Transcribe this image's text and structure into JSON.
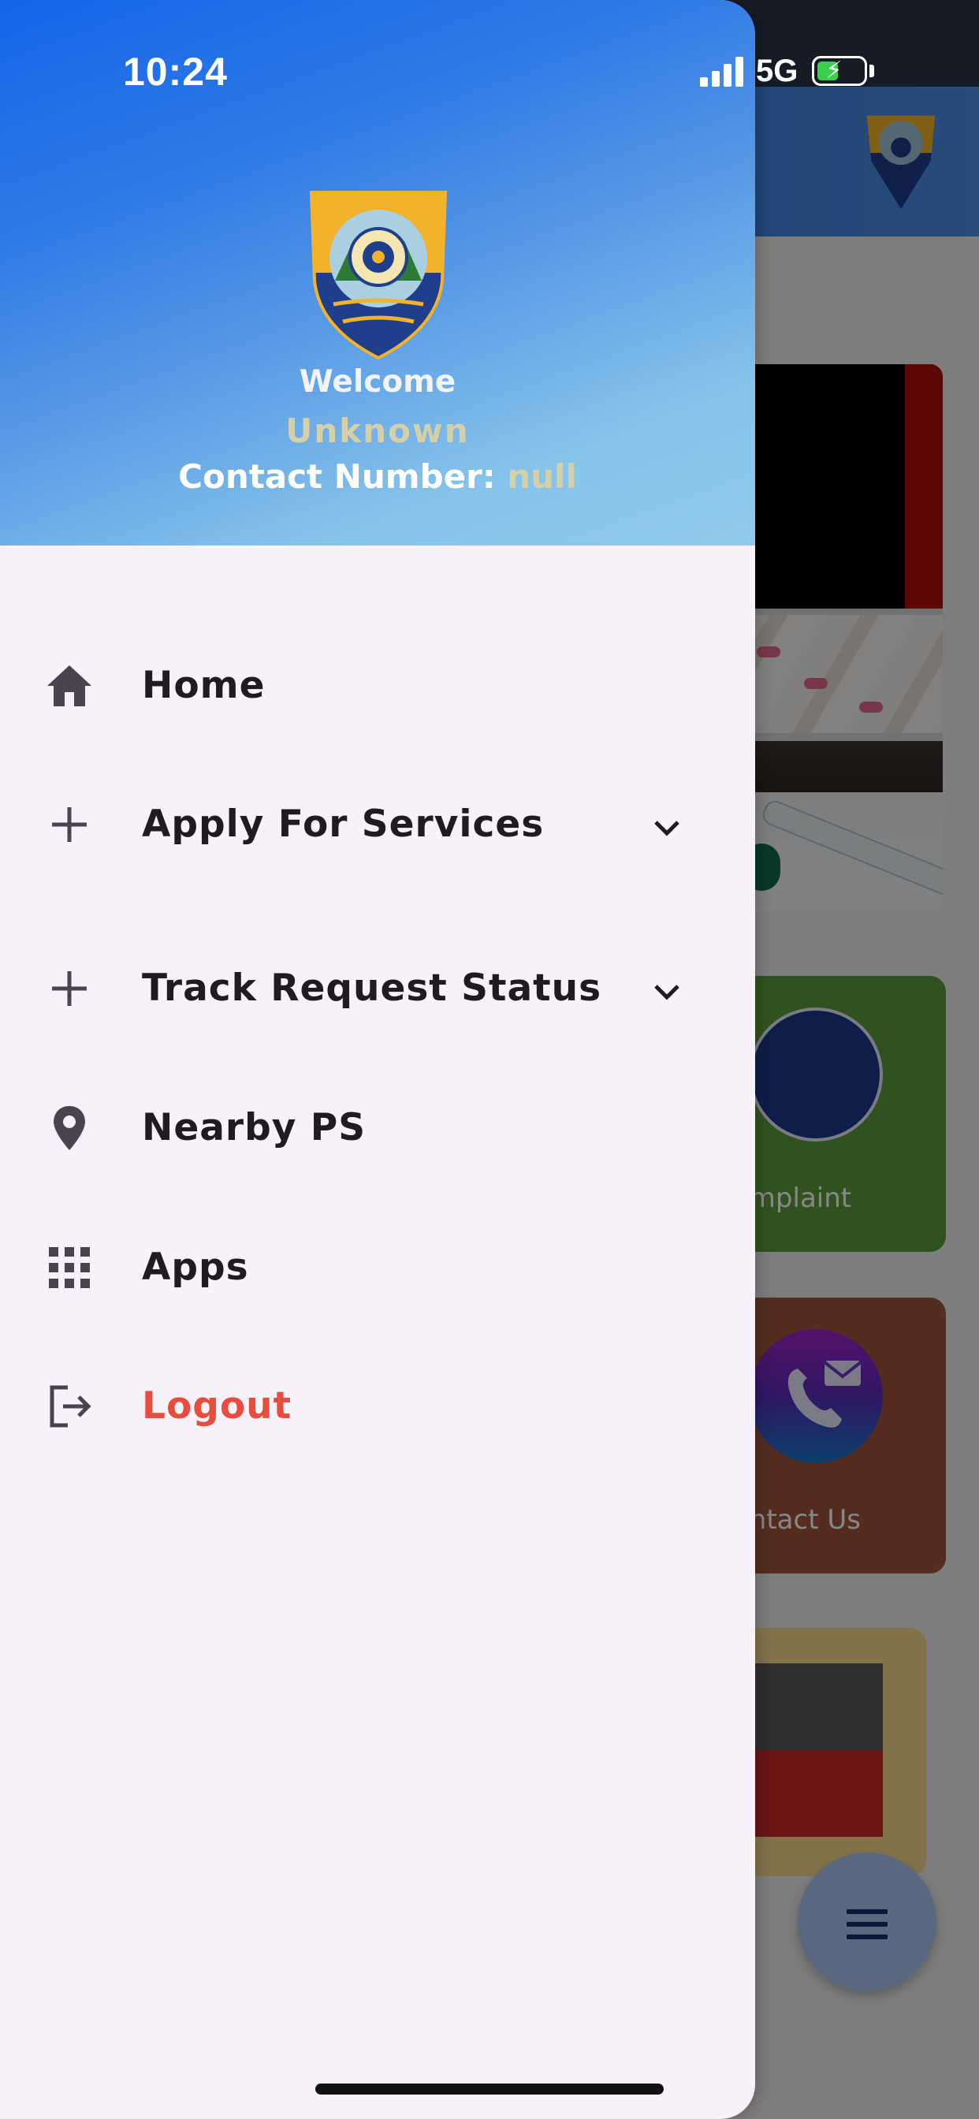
{
  "status_bar": {
    "time": "10:24",
    "network": "5G"
  },
  "drawer": {
    "header": {
      "welcome_label": "Welcome",
      "user_name": "Unknown",
      "contact_label": "Contact Number:",
      "contact_value": "null"
    },
    "menu": [
      {
        "label": "Home",
        "icon": "home-icon"
      },
      {
        "label": "Apply For Services",
        "icon": "plus-icon",
        "expandable": true
      },
      {
        "label": "Track Request Status",
        "icon": "plus-icon",
        "expandable": true
      },
      {
        "label": "Nearby PS",
        "icon": "location-pin-icon"
      },
      {
        "label": "Apps",
        "icon": "apps-grid-icon"
      },
      {
        "label": "Logout",
        "icon": "logout-icon"
      }
    ]
  },
  "background": {
    "tiles": [
      {
        "label": "omplaint"
      },
      {
        "label": "ontact Us"
      }
    ]
  },
  "colors": {
    "header_start": "#1565ea",
    "header_end": "#8fcaea",
    "drawer_bg": "#f7f1f9",
    "logout": "#e74c3c",
    "highlight_text": "#d6d0a8"
  }
}
